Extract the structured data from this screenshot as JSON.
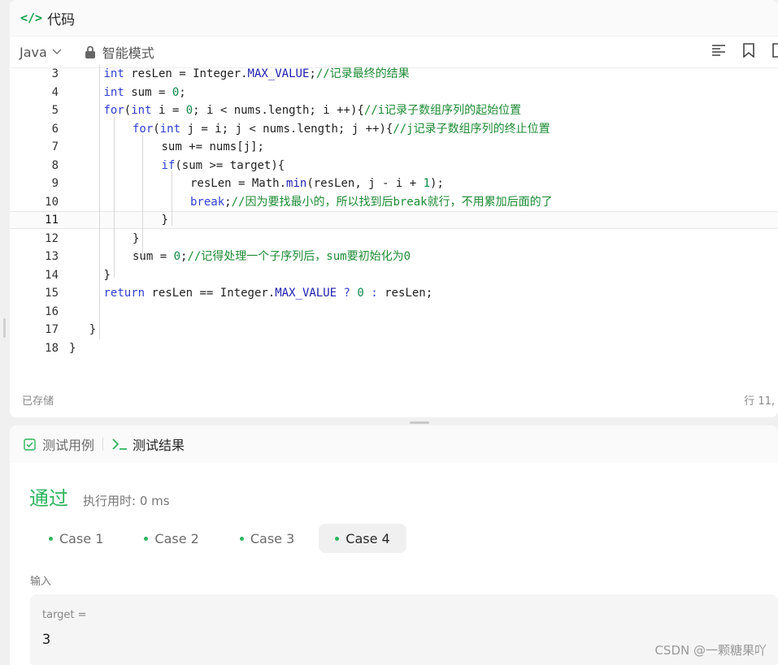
{
  "code_panel": {
    "title": "代码",
    "language": "Java",
    "mode": "智能模式",
    "status_saved": "已存储",
    "status_position": "行 11,",
    "lines": [
      {
        "n": "3",
        "indent": 1,
        "tokens": [
          [
            "tp",
            "int"
          ],
          [
            "",
            "  resLen = Integer."
          ],
          [
            "fld",
            "MAX_VALUE"
          ],
          [
            "",
            ";"
          ],
          [
            "cm",
            "//记录最终的结果"
          ]
        ]
      },
      {
        "n": "4",
        "indent": 1,
        "tokens": [
          [
            "tp",
            "int"
          ],
          [
            "",
            " sum = "
          ],
          [
            "num",
            "0"
          ],
          [
            "",
            ";"
          ]
        ]
      },
      {
        "n": "5",
        "indent": 1,
        "tokens": [
          [
            "kw",
            "for"
          ],
          [
            "",
            "("
          ],
          [
            "tp",
            "int"
          ],
          [
            "",
            " i = "
          ],
          [
            "num",
            "0"
          ],
          [
            "",
            "; i < nums.length; i ++){"
          ],
          [
            "cm",
            "//i记录子数组序列的起始位置"
          ]
        ]
      },
      {
        "n": "6",
        "indent": 2,
        "tokens": [
          [
            "kw",
            "for"
          ],
          [
            "",
            "("
          ],
          [
            "tp",
            "int"
          ],
          [
            "",
            " j = i; j < nums.length; j ++){"
          ],
          [
            "cm",
            "//j记录子数组序列的终止位置"
          ]
        ]
      },
      {
        "n": "7",
        "indent": 3,
        "tokens": [
          [
            "",
            "sum += nums[j];"
          ]
        ]
      },
      {
        "n": "8",
        "indent": 3,
        "tokens": [
          [
            "kw",
            "if"
          ],
          [
            "",
            "(sum >= target){"
          ]
        ]
      },
      {
        "n": "9",
        "indent": 4,
        "tokens": [
          [
            "",
            "resLen = Math."
          ],
          [
            "fld",
            "min"
          ],
          [
            "",
            "(resLen, j - i + "
          ],
          [
            "num",
            "1"
          ],
          [
            "",
            ");"
          ]
        ]
      },
      {
        "n": "10",
        "indent": 4,
        "tokens": [
          [
            "kw",
            "break"
          ],
          [
            "",
            ";"
          ],
          [
            "cm",
            "//因为要找最小的，所以找到后break就行，不用累加后面的了"
          ]
        ]
      },
      {
        "n": "11",
        "indent": 3,
        "active": true,
        "tokens": [
          [
            "",
            "}"
          ]
        ]
      },
      {
        "n": "12",
        "indent": 2,
        "tokens": [
          [
            "",
            "}"
          ]
        ]
      },
      {
        "n": "13",
        "indent": 2,
        "tokens": [
          [
            "",
            "sum = "
          ],
          [
            "num",
            "0"
          ],
          [
            "",
            ";"
          ],
          [
            "cm",
            "//记得处理一个子序列后，sum要初始化为0"
          ]
        ]
      },
      {
        "n": "14",
        "indent": 1,
        "tokens": [
          [
            "",
            "}"
          ]
        ]
      },
      {
        "n": "15",
        "indent": 1,
        "tokens": [
          [
            "kw",
            "return"
          ],
          [
            "",
            " resLen == Integer."
          ],
          [
            "fld",
            "MAX_VALUE"
          ],
          [
            "kw",
            " ? "
          ],
          [
            "num",
            "0"
          ],
          [
            "kw",
            " : "
          ],
          [
            "",
            "resLen;"
          ]
        ]
      },
      {
        "n": "16",
        "indent": 1,
        "tokens": []
      },
      {
        "n": "17",
        "indent": 0.5,
        "tokens": [
          [
            "",
            "}"
          ]
        ]
      },
      {
        "n": "18",
        "indent": 0,
        "tokens": [
          [
            "",
            "}"
          ]
        ]
      }
    ]
  },
  "result_panel": {
    "tab_testcases": "测试用例",
    "tab_results": "测试结果",
    "verdict": "通过",
    "runtime": "执行用时: 0 ms",
    "cases": [
      "Case 1",
      "Case 2",
      "Case 3",
      "Case 4"
    ],
    "active_case": 3,
    "input_label": "输入",
    "param_name": "target =",
    "param_value": "3"
  },
  "watermark": "CSDN @一颗糖果吖",
  "colors": {
    "accent_green": "#2db55d",
    "keyword_blue": "#2f3fd0",
    "comment_green": "#1e8b34"
  }
}
